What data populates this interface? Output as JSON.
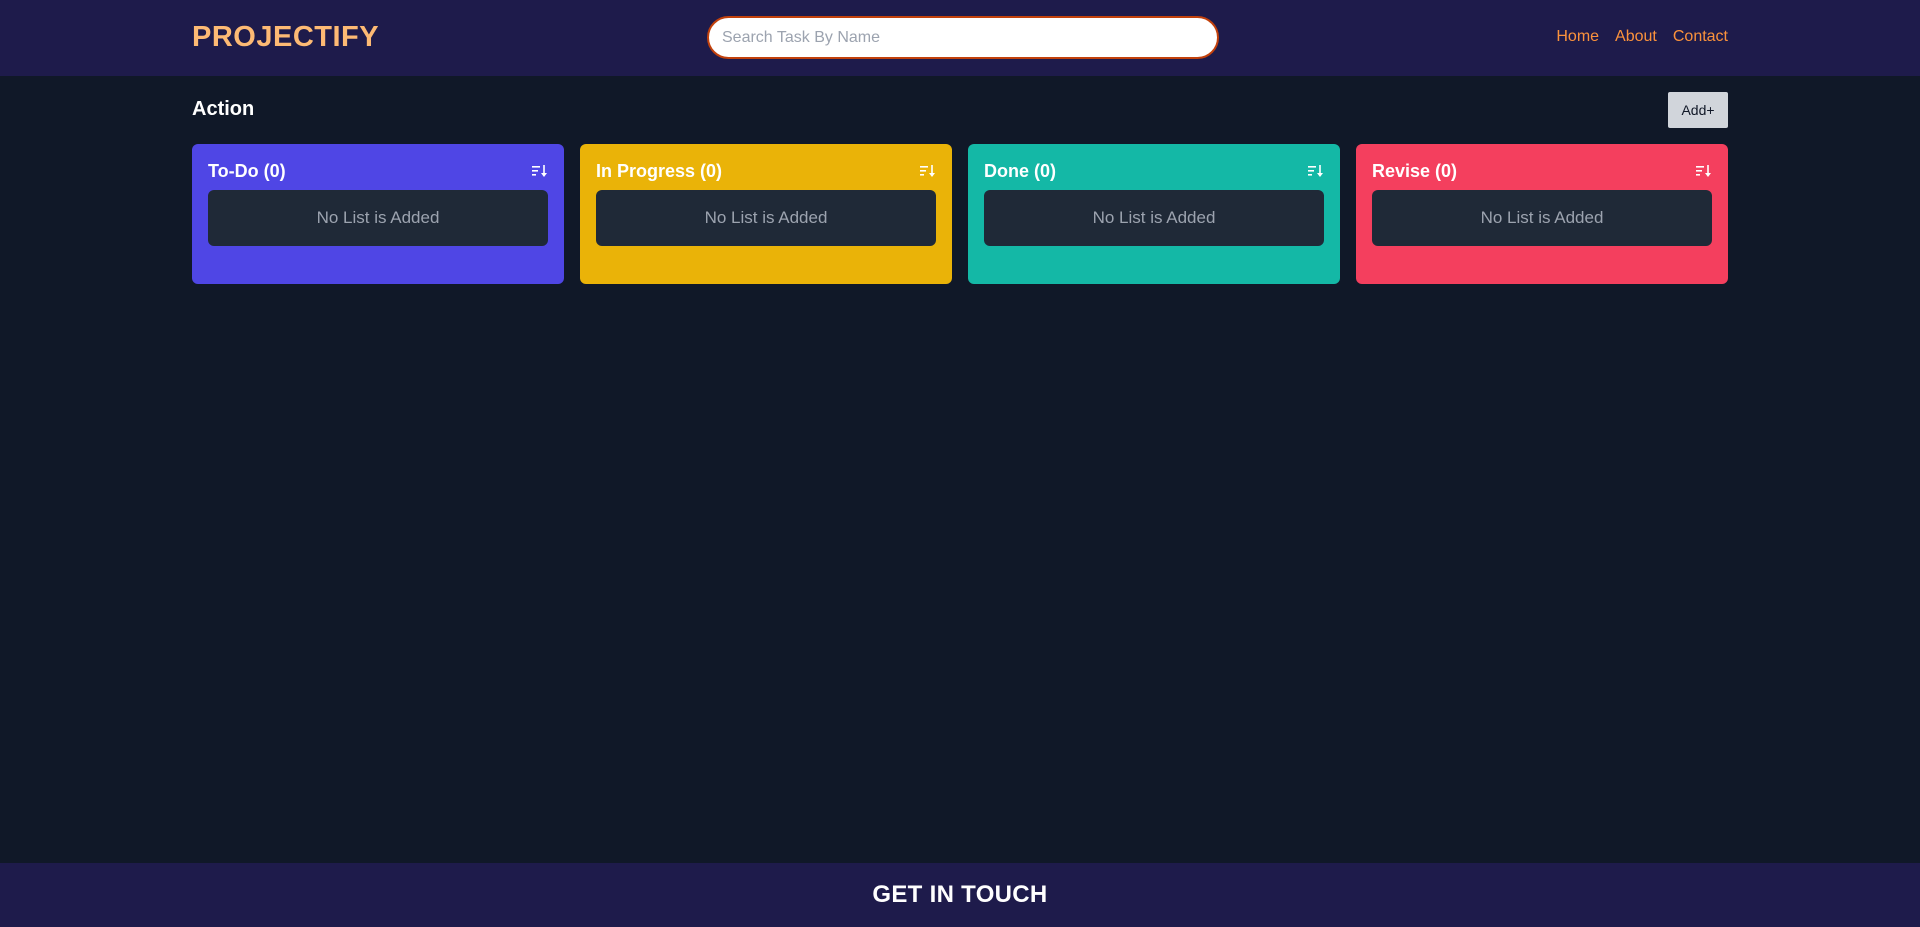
{
  "header": {
    "logo": "PROJECTIFY",
    "search_placeholder": "Search Task By Name",
    "search_value": "",
    "nav": [
      {
        "label": "Home"
      },
      {
        "label": "About"
      },
      {
        "label": "Contact"
      }
    ]
  },
  "action": {
    "title": "Action",
    "add_label": "Add+"
  },
  "columns": [
    {
      "title": "To-Do (0)",
      "empty_text": "No List is Added",
      "color": "#4f46e5",
      "icon": "sort-icon"
    },
    {
      "title": "In Progress (0)",
      "empty_text": "No List is Added",
      "color": "#eab308",
      "icon": "sort-icon"
    },
    {
      "title": "Done (0)",
      "empty_text": "No List is Added",
      "color": "#14b8a6",
      "icon": "sort-icon"
    },
    {
      "title": "Revise (0)",
      "empty_text": "No List is Added",
      "color": "#f43f5e",
      "icon": "sort-icon"
    }
  ],
  "footer": {
    "title": "GET IN TOUCH"
  },
  "colors": {
    "header_bg": "#1e1b4b",
    "page_bg": "#101828",
    "logo": "#fdba74",
    "nav_link": "#fb923c",
    "search_border": "#c2410c"
  }
}
